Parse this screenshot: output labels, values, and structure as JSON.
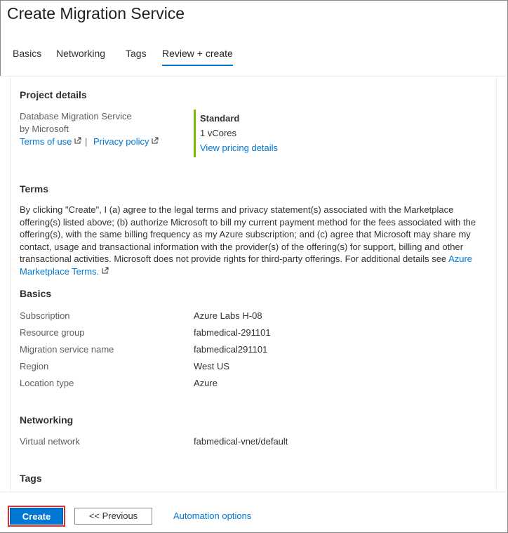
{
  "page": {
    "title": "Create Migration Service"
  },
  "tabs": [
    {
      "label": "Basics",
      "active": false
    },
    {
      "label": "Networking",
      "active": false
    },
    {
      "label": "Tags",
      "active": false
    },
    {
      "label": "Review + create",
      "active": true
    }
  ],
  "project_details": {
    "heading": "Project details",
    "product_name": "Database Migration Service",
    "publisher": "by Microsoft",
    "terms_link": "Terms of use",
    "separator": "|",
    "privacy_link": "Privacy policy",
    "plan_name": "Standard",
    "plan_cores": "1 vCores",
    "pricing_link": "View pricing details",
    "plan_accent_color": "#7fba00"
  },
  "terms": {
    "heading": "Terms",
    "body": "By clicking \"Create\", I (a) agree to the legal terms and privacy statement(s) associated with the Marketplace offering(s) listed above; (b) authorize Microsoft to bill my current payment method for the fees associated with the offering(s), with the same billing frequency as my Azure subscription; and (c) agree that Microsoft may share my contact, usage and transactional information with the provider(s) of the offering(s) for support, billing and other transactional activities. Microsoft does not provide rights for third-party offerings. For additional details see ",
    "marketplace_link": "Azure Marketplace Terms."
  },
  "basics": {
    "heading": "Basics",
    "rows": [
      {
        "label": "Subscription",
        "value": "Azure Labs H-08"
      },
      {
        "label": "Resource group",
        "value": "fabmedical-291101"
      },
      {
        "label": "Migration service name",
        "value": "fabmedical291101"
      },
      {
        "label": "Region",
        "value": "West US"
      },
      {
        "label": "Location type",
        "value": "Azure"
      }
    ]
  },
  "networking": {
    "heading": "Networking",
    "rows": [
      {
        "label": "Virtual network",
        "value": "fabmedical-vnet/default"
      }
    ]
  },
  "tags": {
    "heading": "Tags"
  },
  "footer": {
    "create_label": "Create",
    "previous_label": "<< Previous",
    "automation_label": "Automation options"
  },
  "colors": {
    "accent": "#0078d4",
    "highlight_outline": "#d13438"
  },
  "icons": {
    "external_link": "external-link-icon"
  }
}
